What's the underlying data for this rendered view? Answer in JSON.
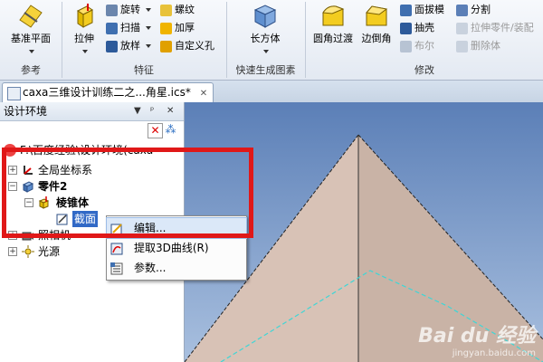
{
  "ribbon": {
    "groups": {
      "reference": {
        "label": "参考",
        "big": "基准平面"
      },
      "feature": {
        "label": "特征",
        "big": "拉伸",
        "smalls": [
          "旋转",
          "扫描",
          "放样",
          "螺纹",
          "加厚",
          "自定义孔"
        ]
      },
      "quick": {
        "label": "快速生成图素",
        "big": "长方体"
      },
      "modify": {
        "label": "修改",
        "bigs": [
          "圆角过渡",
          "边倒角"
        ],
        "smalls": [
          "面拔模",
          "抽壳",
          "布尔",
          "分割",
          "拉伸零件/装配",
          "删除体"
        ]
      }
    }
  },
  "tab": {
    "title": "caxa三维设计训练二之...角星.ics*",
    "close": "✕"
  },
  "panel": {
    "title": "设计环境",
    "tree": {
      "root": "F:\\百度经验\\设计环境(caxa",
      "coords": "全局坐标系",
      "part": "零件2",
      "feature": "棱锥体",
      "section": "截面",
      "camera": "照相机",
      "light": "光源"
    }
  },
  "context_menu": {
    "items": [
      "编辑...",
      "提取3D曲线(R)",
      "参数..."
    ]
  },
  "watermark": {
    "brand": "Bai du 经验",
    "url": "jingyan.baidu.com"
  },
  "colors": {
    "highlight_border": "#e01818",
    "pyramid_left": "#d8c2b6",
    "pyramid_right": "#c9b3a6"
  }
}
